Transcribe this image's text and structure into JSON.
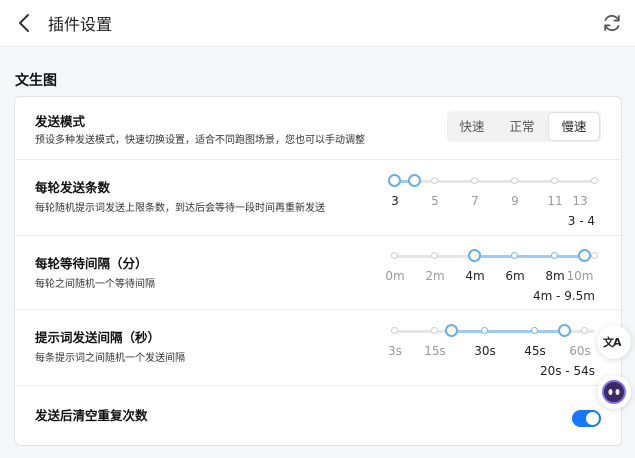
{
  "header": {
    "title": "插件设置"
  },
  "section": {
    "title": "文生图"
  },
  "send_mode": {
    "title": "发送模式",
    "desc": "预设多种发送模式，快速切换设置，适合不同跑图场景，您也可以手动调整",
    "options": [
      "快速",
      "正常",
      "慢速"
    ],
    "selected": "慢速"
  },
  "sliders": [
    {
      "title": "每轮发送条数",
      "desc": "每轮随机提示词发送上限条数，到达后会等待一段时间再重新发送",
      "tick_labels": [
        "3",
        "5",
        "7",
        "9",
        "11",
        "13"
      ],
      "range_low": 3,
      "range_high": 4,
      "min": 3,
      "max": 13,
      "range_text": "3 - 4"
    },
    {
      "title": "每轮等待间隔（分）",
      "desc": "每轮之间随机一个等待间隔",
      "tick_labels": [
        "0m",
        "2m",
        "4m",
        "6m",
        "8m",
        "10m"
      ],
      "range_low": 4,
      "range_high": 9.5,
      "min": 0,
      "max": 10,
      "range_text": "4m - 9.5m"
    },
    {
      "title": "提示词发送间隔（秒）",
      "desc": "每条提示词之间随机一个发送间隔",
      "tick_labels": [
        "3s",
        "15s",
        "30s",
        "45s",
        "60s"
      ],
      "tick_values": [
        3,
        15,
        30,
        45,
        60
      ],
      "range_low": 20,
      "range_high": 54,
      "min": 3,
      "max": 63,
      "range_text": "20s - 54s"
    }
  ],
  "clear_repeat": {
    "title": "发送后清空重复次数",
    "enabled": true
  },
  "floating": {
    "translate_label": "文A"
  },
  "colors": {
    "accent": "#1677ff",
    "slider_fill": "#9ecbf3",
    "handle": "#6aaee8"
  }
}
